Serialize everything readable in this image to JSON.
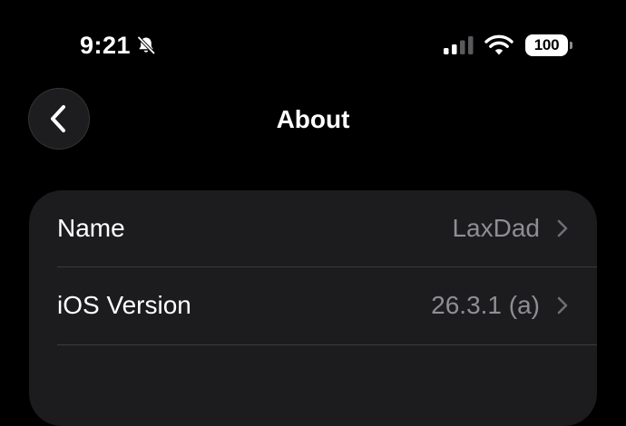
{
  "status_bar": {
    "time": "9:21",
    "silent_icon": "bell-slash-icon",
    "signal_icon": "cellular-signal-icon",
    "wifi_icon": "wifi-icon",
    "battery_level": "100"
  },
  "nav": {
    "back_icon": "chevron-left-icon",
    "title": "About"
  },
  "settings": {
    "rows": [
      {
        "label": "Name",
        "value": "LaxDad"
      },
      {
        "label": "iOS Version",
        "value": "26.3.1 (a)"
      },
      {
        "label": "",
        "value": ""
      }
    ]
  },
  "colors": {
    "background": "#000000",
    "group_background": "#1c1c1e",
    "primary_text": "#ffffff",
    "secondary_text": "#8e8e93",
    "separator": "#3a3a3c"
  }
}
